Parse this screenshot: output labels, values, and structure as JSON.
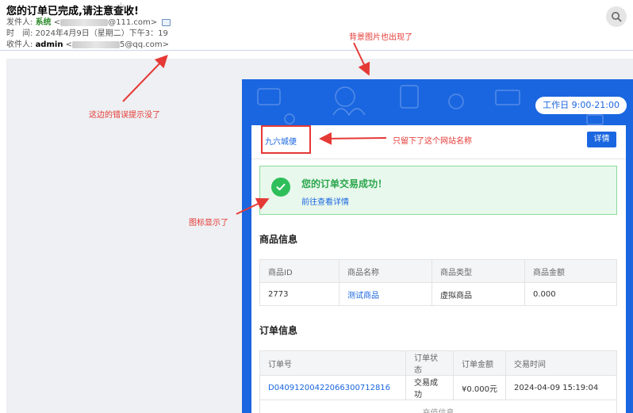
{
  "email": {
    "subject": "您的订单已完成,请注意查收!",
    "sender_label": "发件人:",
    "sender_name": "系统",
    "sender_email_suffix": "@111.com>",
    "time_label": "时　间:",
    "time_value": "2024年4月9日（星期二）下午3：19",
    "recipient_label": "收件人:",
    "recipient_name": "admin",
    "recipient_email_suffix": "5@qq.com>"
  },
  "mail": {
    "hours": "工作日 9:00-21:00",
    "site_name": "九六城便",
    "detail_button": "详情",
    "success_title": "您的订单交易成功！",
    "success_link": "前往查看详情",
    "goods_section_title": "商品信息",
    "goods_headers": [
      "商品ID",
      "商品名称",
      "商品类型",
      "商品金额"
    ],
    "goods_row": [
      "2773",
      "测试商品",
      "虚拟商品",
      "0.000"
    ],
    "order_section_title": "订单信息",
    "order_headers": [
      "订单号",
      "订单状态",
      "订单金额",
      "交易时间"
    ],
    "order_row": [
      "D04091200422066300712816",
      "交易成功",
      "¥0.000元",
      "2024-04-09 15:19:04"
    ],
    "recharge_label": "充值信息"
  },
  "annotations": {
    "bg_image": "背景图片也出现了",
    "error_tip": "这边的错误提示没了",
    "site_name_only": "只留下了这个网站名称",
    "icon_shown": "图标显示了"
  },
  "colors": {
    "brand_blue": "#1a66e0",
    "success_green": "#2ebf5b",
    "annotation_red": "#e53935"
  }
}
